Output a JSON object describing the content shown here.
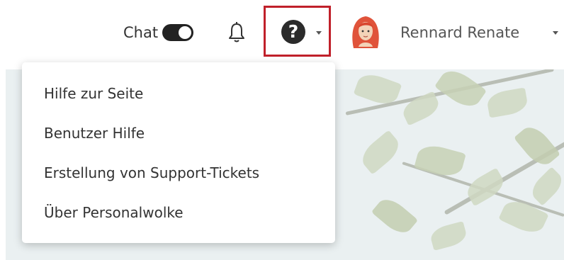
{
  "header": {
    "chat_label": "Chat",
    "chat_toggle_on": true,
    "bell_icon": "bell-icon",
    "help_icon": "question-circle-icon",
    "help_symbol": "?",
    "user_name": "Rennard Renate"
  },
  "help_menu": {
    "items": [
      {
        "label": "Hilfe zur Seite"
      },
      {
        "label": "Benutzer Hilfe"
      },
      {
        "label": "Erstellung von Support-Tickets"
      },
      {
        "label": "Über Personalwolke"
      }
    ]
  },
  "colors": {
    "highlight_border": "#c0202a",
    "avatar_hair": "#e0533a"
  }
}
